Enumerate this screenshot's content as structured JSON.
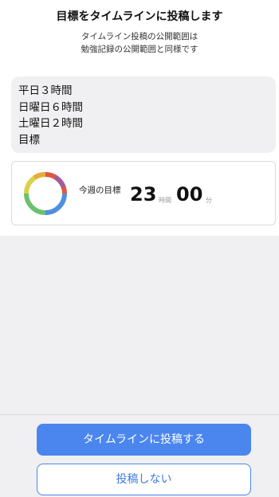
{
  "header": {
    "title": "目標をタイムラインに投稿します",
    "subtitle_lines": [
      "タイムライン投稿の公開範囲は",
      "勉強記録の公開範囲と同様です"
    ]
  },
  "goal_box": {
    "lines": [
      "平日３時間",
      "日曜日６時間",
      "土曜日２時間",
      "目標"
    ]
  },
  "weekly_goal": {
    "label": "今週の目標",
    "hours": "23",
    "hours_unit": "時間",
    "minutes": "00",
    "minutes_unit": "分",
    "ring_colors": [
      "#e8a33a",
      "#e0573f",
      "#8a5cc6",
      "#4f8fe0",
      "#6cc070",
      "#d9d24a"
    ]
  },
  "actions": {
    "post_label": "タイムラインに投稿する",
    "cancel_label": "投稿しない"
  },
  "colors": {
    "accent": "#4a86ee",
    "background": "#f0f0f3"
  }
}
